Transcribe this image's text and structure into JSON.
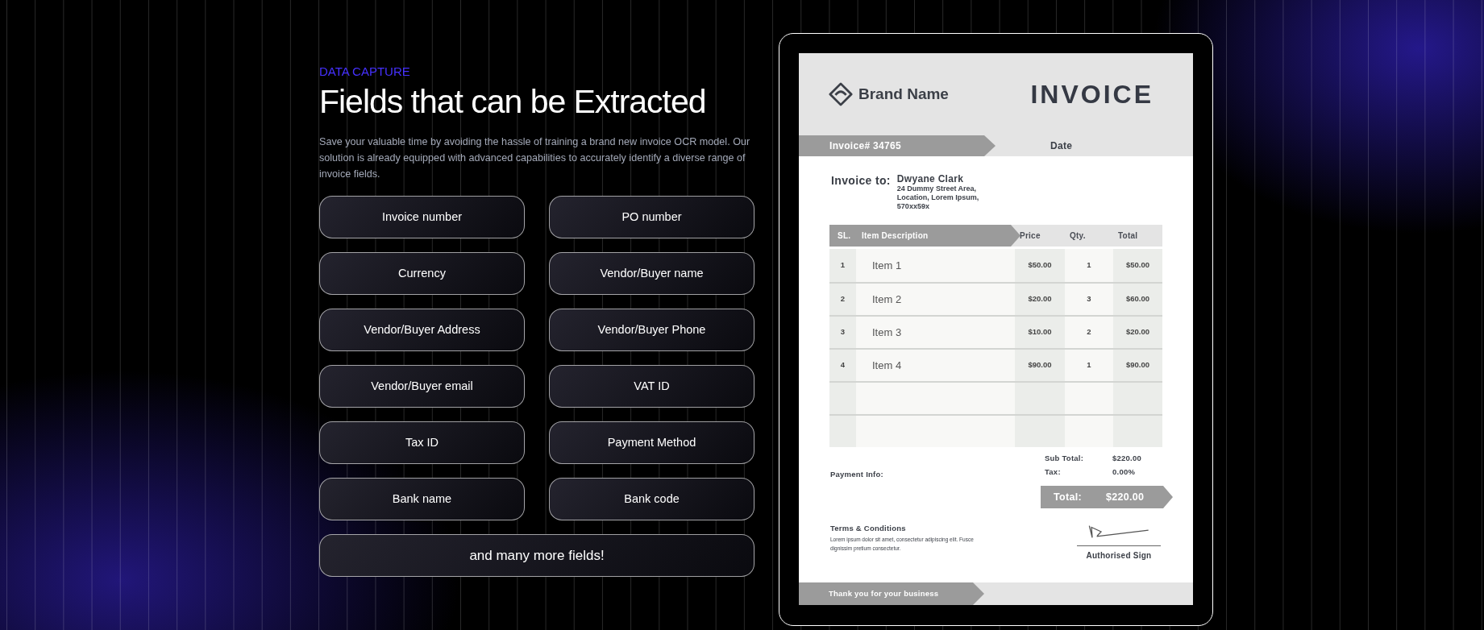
{
  "section_label": "DATA CAPTURE",
  "title": "Fields that can be Extracted",
  "description": "Save your valuable time by avoiding the hassle of training a brand new invoice OCR model. Our solution is already equipped with advanced capabilities to accurately identify a diverse range of invoice fields.",
  "fields": [
    {
      "label": "Invoice number",
      "wide": false
    },
    {
      "label": "PO number",
      "wide": false
    },
    {
      "label": "Currency",
      "wide": false
    },
    {
      "label": "Vendor/Buyer name",
      "wide": false
    },
    {
      "label": "Vendor/Buyer Address",
      "wide": false
    },
    {
      "label": "Vendor/Buyer Phone",
      "wide": false
    },
    {
      "label": "Vendor/Buyer email",
      "wide": false
    },
    {
      "label": "VAT ID",
      "wide": false
    },
    {
      "label": "Tax ID",
      "wide": false
    },
    {
      "label": "Payment Method",
      "wide": false
    },
    {
      "label": "Bank name",
      "wide": false
    },
    {
      "label": "Bank code",
      "wide": false
    },
    {
      "label": "and many more fields!",
      "wide": true
    }
  ],
  "invoice": {
    "brand_name": "Brand Name",
    "heading": "INVOICE",
    "number_label": "Invoice# 34765",
    "date_label": "Date",
    "bill_to_label": "Invoice to:",
    "customer_name": "Dwyane Clark",
    "address_lines": [
      "24 Dummy Street Area,",
      "Location, Lorem Ipsum,",
      "570xx59x"
    ],
    "columns": [
      "SL.",
      "Item Description",
      "Price",
      "Qty.",
      "Total"
    ],
    "rows": [
      [
        "1",
        "Item 1",
        "$50.00",
        "1",
        "$50.00"
      ],
      [
        "2",
        "Item 2",
        "$20.00",
        "3",
        "$60.00"
      ],
      [
        "3",
        "Item 3",
        "$10.00",
        "2",
        "$20.00"
      ],
      [
        "4",
        "Item 4",
        "$90.00",
        "1",
        "$90.00"
      ]
    ],
    "totals": [
      {
        "label": "Sub Total:",
        "value": "$220.00"
      },
      {
        "label": "Tax:",
        "value": "0.00%"
      }
    ],
    "payment_info_label": "Payment Info:",
    "grand_total": {
      "label": "Total:",
      "value": "$220.00"
    },
    "terms_title": "Terms & Conditions",
    "terms_text": "Lorem ipsum dolor sit amet, consectetur adipiscing elit. Fusce dignissim pretium consectetur.",
    "signature_label": "Authorised Sign",
    "footer": "Thank you for your business"
  }
}
